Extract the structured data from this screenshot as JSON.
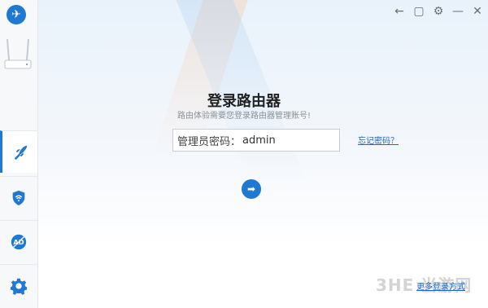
{
  "login": {
    "title": "登录路由器",
    "subtitle": "路由体验需要您登录路由器管理账号!",
    "password_label": "管理员密码：",
    "password_value": "admin",
    "forgot_link": "忘记密码？",
    "submit_icon": "arrow-right-icon"
  },
  "footer": {
    "link": "更多登录方式"
  },
  "watermark": {
    "text": "3HE 当游网"
  },
  "sidebar": {
    "items": [
      {
        "icon": "rocket-icon",
        "active": true
      },
      {
        "icon": "wifi-shield-icon"
      },
      {
        "icon": "ad-block-icon"
      },
      {
        "icon": "settings-icon"
      }
    ]
  },
  "topbar": {
    "buttons": [
      "back-icon",
      "feedback-icon",
      "settings-icon",
      "minimize-icon",
      "close-icon"
    ]
  },
  "colors": {
    "accent": "#1f78d1"
  }
}
